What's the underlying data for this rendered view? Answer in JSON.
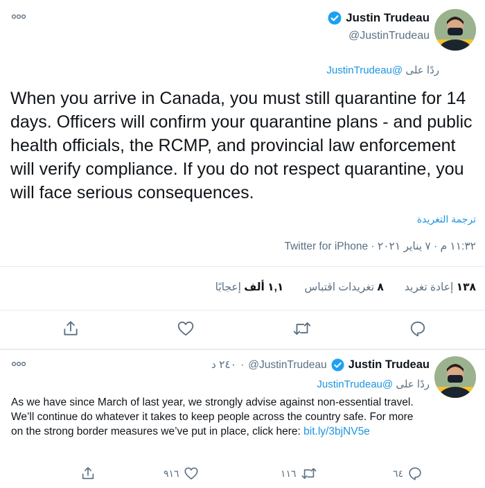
{
  "main_tweet": {
    "author_name": "Justin Trudeau",
    "author_handle": "@JustinTrudeau",
    "replying_to_prefix": "ردًا على",
    "replying_to_handle": "@JustinTrudeau",
    "text": "When you arrive in Canada, you must still quarantine for 14 days. Officers will confirm your quarantine plans - and public health officials, the RCMP, and provincial law enforcement will verify compliance. If you do not respect quarantine, you will face serious consequences.",
    "translate_label": "ترجمة التغريدة",
    "timestamp": "١١:٣٢ م · ٧ يناير ٢٠٢١ · Twitter for iPhone",
    "stats": {
      "retweets_count": "١٣٨",
      "retweets_label": "إعادة تغريد",
      "quotes_count": "٨",
      "quotes_label": "تغريدات اقتباس",
      "likes_count": "١,١ ألف",
      "likes_label": "إعجابًا"
    }
  },
  "reply_tweet": {
    "author_name": "Justin Trudeau",
    "author_handle": "@JustinTrudeau",
    "time": "٢٤٠ د",
    "replying_to_prefix": "ردًا على",
    "replying_to_handle": "@JustinTrudeau",
    "text": "As we have since March of last year, we strongly advise against non-essential travel. We’ll continue do whatever it takes to keep people across the country safe. For more on the strong border measures we’ve put in place, click here: ",
    "link": "bit.ly/3bjNV5e",
    "reply_count": "٦٤",
    "retweet_count": "١١٦",
    "like_count": "٩١٦"
  },
  "colors": {
    "accent": "#1b95e0",
    "verified": "#1da1f2",
    "muted": "#5b7083",
    "divider": "#e6ecf0"
  },
  "icons": [
    "more-icon",
    "verified-badge-icon",
    "reply-icon",
    "retweet-icon",
    "like-icon",
    "share-icon"
  ]
}
